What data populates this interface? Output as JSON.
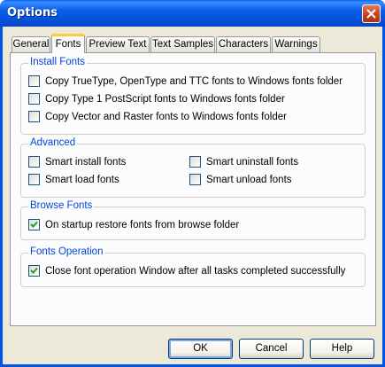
{
  "window": {
    "title": "Options"
  },
  "tabs": [
    {
      "label": "General",
      "active": false
    },
    {
      "label": "Fonts",
      "active": true
    },
    {
      "label": "Preview Text",
      "active": false
    },
    {
      "label": "Text Samples",
      "active": false
    },
    {
      "label": "Characters",
      "active": false
    },
    {
      "label": "Warnings",
      "active": false
    }
  ],
  "groups": {
    "install": {
      "title": "Install Fonts",
      "items": [
        {
          "label": "Copy TrueType, OpenType and TTC fonts to Windows fonts folder",
          "checked": false
        },
        {
          "label": "Copy Type 1 PostScript fonts to Windows fonts folder",
          "checked": false
        },
        {
          "label": "Copy Vector and Raster fonts to Windows fonts folder",
          "checked": false
        }
      ]
    },
    "advanced": {
      "title": "Advanced",
      "items": [
        {
          "label": "Smart install fonts",
          "checked": false
        },
        {
          "label": "Smart uninstall fonts",
          "checked": false
        },
        {
          "label": "Smart load fonts",
          "checked": false
        },
        {
          "label": "Smart unload fonts",
          "checked": false
        }
      ]
    },
    "browse": {
      "title": "Browse Fonts",
      "items": [
        {
          "label": "On startup restore fonts from browse folder",
          "checked": true
        }
      ]
    },
    "operation": {
      "title": "Fonts Operation",
      "items": [
        {
          "label": "Close font operation Window after all tasks completed successfully",
          "checked": true
        }
      ]
    }
  },
  "buttons": {
    "ok": "OK",
    "cancel": "Cancel",
    "help": "Help"
  },
  "colors": {
    "titlebar": "#0553dc",
    "group_title": "#0046d5",
    "checkmark": "#21a121",
    "tab_highlight": "#ffc83c"
  }
}
